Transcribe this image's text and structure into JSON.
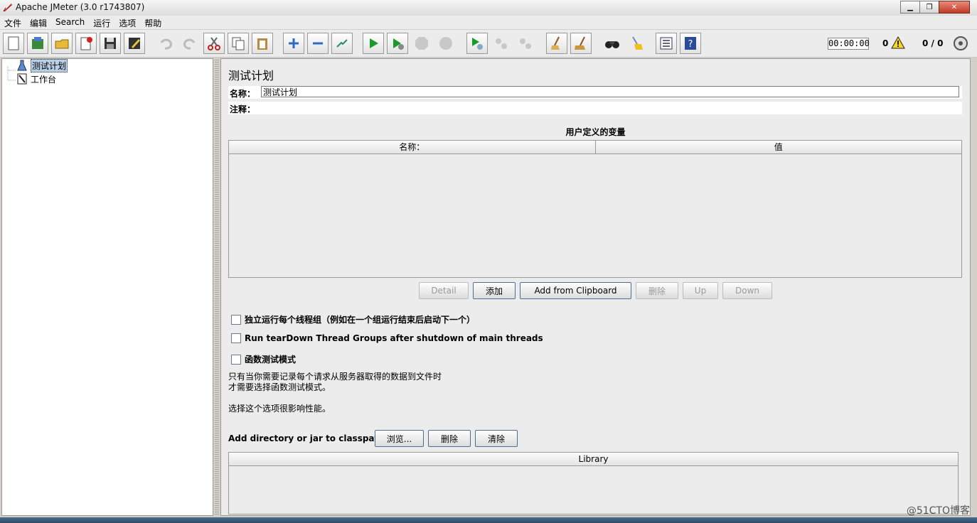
{
  "window": {
    "title": "Apache JMeter (3.0 r1743807)",
    "minimize": "▁",
    "maximize": "❐",
    "close": "✕"
  },
  "menu": [
    "文件",
    "编辑",
    "Search",
    "运行",
    "选项",
    "帮助"
  ],
  "status": {
    "timer": "00:00:00",
    "warnings": "0",
    "threads": "0 / 0"
  },
  "tree": {
    "items": [
      {
        "label": "测试计划",
        "icon": "test-plan-icon"
      },
      {
        "label": "工作台",
        "icon": "workbench-icon"
      }
    ]
  },
  "plan": {
    "title": "测试计划",
    "name_label": "名称：",
    "name_value": "测试计划",
    "comment_label": "注释：",
    "vars_title": "用户定义的变量",
    "vars_columns": [
      "名称：",
      "值"
    ],
    "buttons": [
      "Detail",
      "添加",
      "Add from Clipboard",
      "删除",
      "Up",
      "Down"
    ],
    "checks": [
      "独立运行每个线程组（例如在一个组运行结束后启动下一个）",
      "Run tearDown Thread Groups after shutdown of main threads",
      "函数测试模式"
    ],
    "note1": "只有当你需要记录每个请求从服务器取得的数据到文件时",
    "note2": "才需要选择函数测试模式。",
    "note3": "选择这个选项很影响性能。",
    "classpath_label": "Add directory or jar to classpath",
    "classpath_buttons": [
      "浏览...",
      "删除",
      "清除"
    ],
    "library_column": "Library"
  },
  "watermark": "@51CTO博客",
  "colors": {
    "selection": "#b8cfe5",
    "window_bg": "#ececec",
    "run_green": "#1a9a2a"
  }
}
